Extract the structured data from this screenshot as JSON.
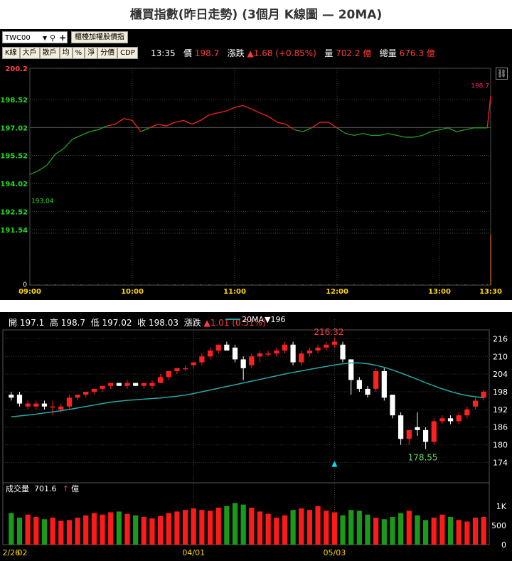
{
  "title": "櫃買指數(昨日走勢) (3個月 K線圖  — 20MA)",
  "intraday": {
    "symbol": "TWC00",
    "index_button": "櫃檯加權股價指",
    "tools": [
      "K線",
      "大戶",
      "散戶",
      "均",
      "%",
      "淨",
      "分價",
      "CDP"
    ],
    "time": "13:35",
    "price_label": "價",
    "price": "198.7",
    "change_label": "漲跌",
    "change": "▲1.68 (+0.85%)",
    "volume_label": "量",
    "volume": "702.2 億",
    "total_volume_label": "總量",
    "total_volume": "676.3 億",
    "low_label": "193.04",
    "last_label": "198.7",
    "zero_label": "0",
    "colors": {
      "up": "#ff2020",
      "down": "#1fa11f",
      "volume": "#ff8c00",
      "ref": "#00ff00"
    }
  },
  "daily": {
    "ohlc": {
      "open_label": "開",
      "open": "197.1",
      "high_label": "高",
      "high": "198.7",
      "low_label": "低",
      "low": "197.02",
      "close_label": "收",
      "close": "198.03",
      "change_label": "漲跌",
      "change": "▲1.01 (0.51%)"
    },
    "ma_legend": "20MA",
    "ma_value": "▼196",
    "max_label": "216.32",
    "min_label": "178.55",
    "volume_title": "成交量",
    "volume_value": "701.6",
    "volume_unit": "億",
    "colors": {
      "up": "#ff2020",
      "down": "#ffffff",
      "ma": "#2aa5a5",
      "vol_up": "#ff1a1a",
      "vol_down": "#1a9a1a",
      "marker": "#00e5ff"
    }
  },
  "chart_data": [
    {
      "type": "line",
      "x_ticks": [
        "09:00",
        "10:00",
        "11:00",
        "12:00",
        "13:00",
        "13:30"
      ],
      "y_ticks": [
        200.2,
        198.52,
        197.02,
        195.52,
        194.02,
        192.52,
        191.54
      ],
      "ylim": [
        191.54,
        200.2
      ],
      "reference": 197.02,
      "x_minutes": [
        0,
        5,
        10,
        15,
        20,
        25,
        30,
        35,
        40,
        45,
        50,
        55,
        60,
        65,
        70,
        75,
        80,
        85,
        90,
        95,
        100,
        105,
        110,
        115,
        120,
        125,
        130,
        135,
        140,
        145,
        150,
        155,
        160,
        165,
        170,
        175,
        180,
        185,
        190,
        195,
        200,
        205,
        210,
        215,
        220,
        225,
        230,
        235,
        240,
        245,
        250,
        255,
        260,
        265,
        268,
        270
      ],
      "y": [
        194.5,
        194.7,
        195.0,
        195.6,
        195.9,
        196.4,
        196.6,
        196.8,
        196.9,
        197.1,
        197.2,
        197.5,
        197.4,
        196.8,
        197.0,
        197.2,
        197.1,
        197.3,
        197.4,
        197.2,
        197.4,
        197.7,
        197.8,
        197.9,
        198.1,
        198.2,
        198.0,
        197.8,
        197.6,
        197.3,
        197.2,
        196.9,
        196.8,
        197.0,
        197.3,
        197.3,
        197.0,
        196.7,
        196.6,
        196.7,
        196.6,
        196.6,
        196.7,
        196.6,
        196.5,
        196.5,
        196.6,
        196.8,
        196.9,
        197.0,
        196.8,
        196.9,
        197.0,
        197.0,
        197.0,
        198.7
      ],
      "volume": [
        0.6,
        0.5,
        0.5,
        0.4,
        0.4,
        0.4,
        0.4,
        0.4,
        0.4,
        0.4,
        0.3,
        0.3,
        0.3,
        0.3,
        0.3,
        0.3,
        0.3,
        0.3,
        0.3,
        0.3,
        0.3,
        0.3,
        0.3,
        0.3,
        0.3,
        0.3,
        0.3,
        0.3,
        0.3,
        0.3,
        0.3,
        0.3,
        0.3,
        0.3,
        0.3,
        0.3,
        0.3,
        0.3,
        0.3,
        0.3,
        0.3,
        0.3,
        0.3,
        0.3,
        0.3,
        0.3,
        0.3,
        0.3,
        0.3,
        0.3,
        0.3,
        0.3,
        0.3,
        0.3,
        0.3,
        100
      ]
    },
    {
      "type": "candlestick",
      "x_ticks": [
        {
          "label": "2/26",
          "index": 0
        },
        {
          "label": "02",
          "index": 1
        },
        {
          "label": "04/01",
          "index": 22
        },
        {
          "label": "05/03",
          "index": 39
        }
      ],
      "y_ticks": [
        216,
        210,
        204,
        198,
        192,
        186,
        180,
        174
      ],
      "ylim": [
        170,
        219
      ],
      "volume_ticks": [
        "1K",
        "500",
        "0"
      ],
      "volume_ylim": [
        0,
        1200
      ],
      "candles": [
        {
          "o": 197,
          "h": 198,
          "l": 195,
          "c": 196
        },
        {
          "o": 197,
          "h": 198,
          "l": 193,
          "c": 194
        },
        {
          "o": 193,
          "h": 195,
          "l": 192,
          "c": 194
        },
        {
          "o": 193,
          "h": 195,
          "l": 192,
          "c": 194
        },
        {
          "o": 194,
          "h": 195,
          "l": 192,
          "c": 193
        },
        {
          "o": 193,
          "h": 195,
          "l": 190,
          "c": 193
        },
        {
          "o": 192,
          "h": 194,
          "l": 191,
          "c": 193
        },
        {
          "o": 193,
          "h": 197,
          "l": 192,
          "c": 196
        },
        {
          "o": 196,
          "h": 197,
          "l": 195,
          "c": 197
        },
        {
          "o": 197,
          "h": 198,
          "l": 196,
          "c": 198
        },
        {
          "o": 198,
          "h": 199,
          "l": 197,
          "c": 199
        },
        {
          "o": 199,
          "h": 200,
          "l": 198,
          "c": 200
        },
        {
          "o": 200,
          "h": 201,
          "l": 199,
          "c": 201
        },
        {
          "o": 201,
          "h": 201,
          "l": 200,
          "c": 200
        },
        {
          "o": 200,
          "h": 202,
          "l": 199,
          "c": 201
        },
        {
          "o": 201,
          "h": 201,
          "l": 200,
          "c": 200
        },
        {
          "o": 200,
          "h": 201,
          "l": 199,
          "c": 201
        },
        {
          "o": 200,
          "h": 202,
          "l": 199,
          "c": 201
        },
        {
          "o": 201,
          "h": 204,
          "l": 201,
          "c": 203
        },
        {
          "o": 203,
          "h": 205,
          "l": 202,
          "c": 205
        },
        {
          "o": 205,
          "h": 206,
          "l": 204,
          "c": 206
        },
        {
          "o": 206,
          "h": 207,
          "l": 205,
          "c": 206
        },
        {
          "o": 207,
          "h": 208,
          "l": 206,
          "c": 208
        },
        {
          "o": 208,
          "h": 211,
          "l": 207,
          "c": 210
        },
        {
          "o": 210,
          "h": 213,
          "l": 209,
          "c": 212
        },
        {
          "o": 212,
          "h": 214,
          "l": 211,
          "c": 214
        },
        {
          "o": 214,
          "h": 215,
          "l": 212,
          "c": 212
        },
        {
          "o": 213,
          "h": 214,
          "l": 208,
          "c": 209
        },
        {
          "o": 209,
          "h": 210,
          "l": 202,
          "c": 206
        },
        {
          "o": 207,
          "h": 211,
          "l": 206,
          "c": 210
        },
        {
          "o": 210,
          "h": 212,
          "l": 208,
          "c": 211
        },
        {
          "o": 211,
          "h": 212,
          "l": 210,
          "c": 211
        },
        {
          "o": 211,
          "h": 213,
          "l": 210,
          "c": 212
        },
        {
          "o": 212,
          "h": 215,
          "l": 211,
          "c": 214
        },
        {
          "o": 214,
          "h": 215,
          "l": 207,
          "c": 208
        },
        {
          "o": 208,
          "h": 212,
          "l": 207,
          "c": 211
        },
        {
          "o": 211,
          "h": 213,
          "l": 210,
          "c": 212
        },
        {
          "o": 212,
          "h": 214,
          "l": 211,
          "c": 213
        },
        {
          "o": 213,
          "h": 215,
          "l": 212,
          "c": 214
        },
        {
          "o": 214,
          "h": 216.32,
          "l": 213,
          "c": 215
        },
        {
          "o": 214,
          "h": 215,
          "l": 208,
          "c": 209
        },
        {
          "o": 209,
          "h": 209,
          "l": 197,
          "c": 202
        },
        {
          "o": 202,
          "h": 203,
          "l": 198,
          "c": 199
        },
        {
          "o": 199,
          "h": 200,
          "l": 196,
          "c": 197
        },
        {
          "o": 199,
          "h": 206,
          "l": 198,
          "c": 205
        },
        {
          "o": 205,
          "h": 206,
          "l": 195,
          "c": 196
        },
        {
          "o": 197,
          "h": 197,
          "l": 189,
          "c": 190
        },
        {
          "o": 190,
          "h": 191,
          "l": 180,
          "c": 182
        },
        {
          "o": 182,
          "h": 184,
          "l": 180,
          "c": 185
        },
        {
          "o": 186,
          "h": 191,
          "l": 183,
          "c": 185
        },
        {
          "o": 185,
          "h": 186,
          "l": 178.55,
          "c": 181
        },
        {
          "o": 181,
          "h": 189,
          "l": 180,
          "c": 188
        },
        {
          "o": 188,
          "h": 190,
          "l": 187,
          "c": 189
        },
        {
          "o": 189,
          "h": 190,
          "l": 187,
          "c": 188
        },
        {
          "o": 188,
          "h": 191,
          "l": 187,
          "c": 190
        },
        {
          "o": 190,
          "h": 193,
          "l": 189,
          "c": 192
        },
        {
          "o": 193,
          "h": 196,
          "l": 192,
          "c": 195
        },
        {
          "o": 196,
          "h": 198.7,
          "l": 195,
          "c": 198.03
        }
      ],
      "ma20": [
        189.5,
        189.8,
        190.1,
        190.4,
        190.8,
        191.2,
        191.6,
        192.0,
        192.5,
        193.0,
        193.5,
        194.0,
        194.5,
        194.8,
        195.1,
        195.3,
        195.5,
        195.7,
        195.9,
        196.2,
        196.5,
        196.9,
        197.4,
        198.0,
        198.6,
        199.2,
        199.8,
        200.4,
        201.0,
        201.6,
        202.2,
        202.8,
        203.4,
        204.0,
        204.6,
        205.1,
        205.6,
        206.1,
        206.6,
        207.1,
        207.5,
        207.8,
        207.8,
        207.5,
        207.0,
        206.3,
        205.4,
        204.4,
        203.3,
        202.2,
        201.1,
        200.0,
        199.0,
        198.1,
        197.3,
        196.7,
        196.3,
        196.0
      ],
      "volume": [
        820,
        700,
        780,
        720,
        660,
        700,
        620,
        640,
        700,
        760,
        820,
        780,
        840,
        860,
        800,
        760,
        720,
        680,
        740,
        820,
        860,
        900,
        940,
        900,
        880,
        960,
        1000,
        1080,
        1040,
        960,
        860,
        800,
        700,
        760,
        900,
        940,
        900,
        1000,
        880,
        840,
        760,
        900,
        880,
        780,
        700,
        660,
        720,
        820,
        880,
        760,
        640,
        700,
        780,
        720,
        640,
        600,
        700,
        720
      ]
    }
  ]
}
